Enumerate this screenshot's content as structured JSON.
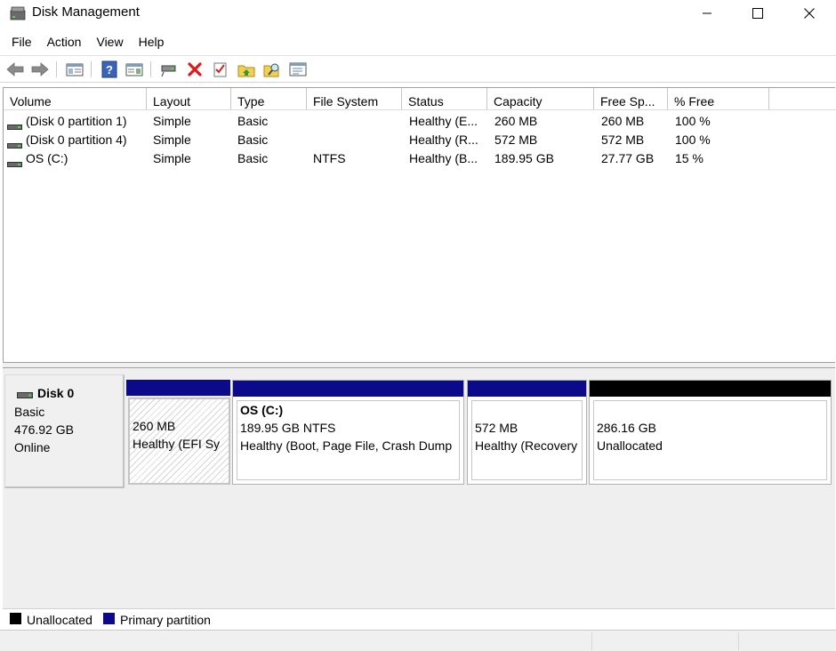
{
  "window": {
    "title": "Disk Management"
  },
  "menu": [
    "File",
    "Action",
    "View",
    "Help"
  ],
  "toolbar": {
    "buttons": [
      "back-icon",
      "forward-icon",
      "show-hide-console-tree-icon",
      "help-icon",
      "show-hide-action-pane-icon",
      "connect-disk-icon",
      "delete-icon",
      "check-icon",
      "up-folder-icon",
      "find-icon",
      "properties-icon"
    ]
  },
  "volume_list": {
    "columns": [
      "Volume",
      "Layout",
      "Type",
      "File System",
      "Status",
      "Capacity",
      "Free Sp...",
      "% Free"
    ],
    "rows": [
      {
        "volume": "(Disk 0 partition 1)",
        "layout": "Simple",
        "type": "Basic",
        "fs": "",
        "status": "Healthy (E...",
        "capacity": "260 MB",
        "free": "260 MB",
        "pct": "100 %"
      },
      {
        "volume": "(Disk 0 partition 4)",
        "layout": "Simple",
        "type": "Basic",
        "fs": "",
        "status": "Healthy (R...",
        "capacity": "572 MB",
        "free": "572 MB",
        "pct": "100 %"
      },
      {
        "volume": "OS (C:)",
        "layout": "Simple",
        "type": "Basic",
        "fs": "NTFS",
        "status": "Healthy (B...",
        "capacity": "189.95 GB",
        "free": "27.77 GB",
        "pct": "15 %"
      }
    ]
  },
  "disk": {
    "name": "Disk 0",
    "type": "Basic",
    "size": "476.92 GB",
    "state": "Online",
    "partitions": [
      {
        "title": "",
        "size": "260 MB",
        "status": "Healthy (EFI Sy",
        "kind": "primary",
        "selected": true
      },
      {
        "title": "OS  (C:)",
        "size": "189.95 GB NTFS",
        "status": "Healthy (Boot, Page File, Crash Dump",
        "kind": "primary",
        "selected": false
      },
      {
        "title": "",
        "size": "572 MB",
        "status": "Healthy (Recovery",
        "kind": "primary",
        "selected": false
      },
      {
        "title": "",
        "size": "286.16 GB",
        "status": "Unallocated",
        "kind": "unallocated",
        "selected": false
      }
    ]
  },
  "legend": [
    {
      "label": "Unallocated",
      "color": "#000000"
    },
    {
      "label": "Primary partition",
      "color": "#0a0a8a"
    }
  ],
  "colors": {
    "primary": "#0a0a8a",
    "unallocated": "#000000"
  }
}
